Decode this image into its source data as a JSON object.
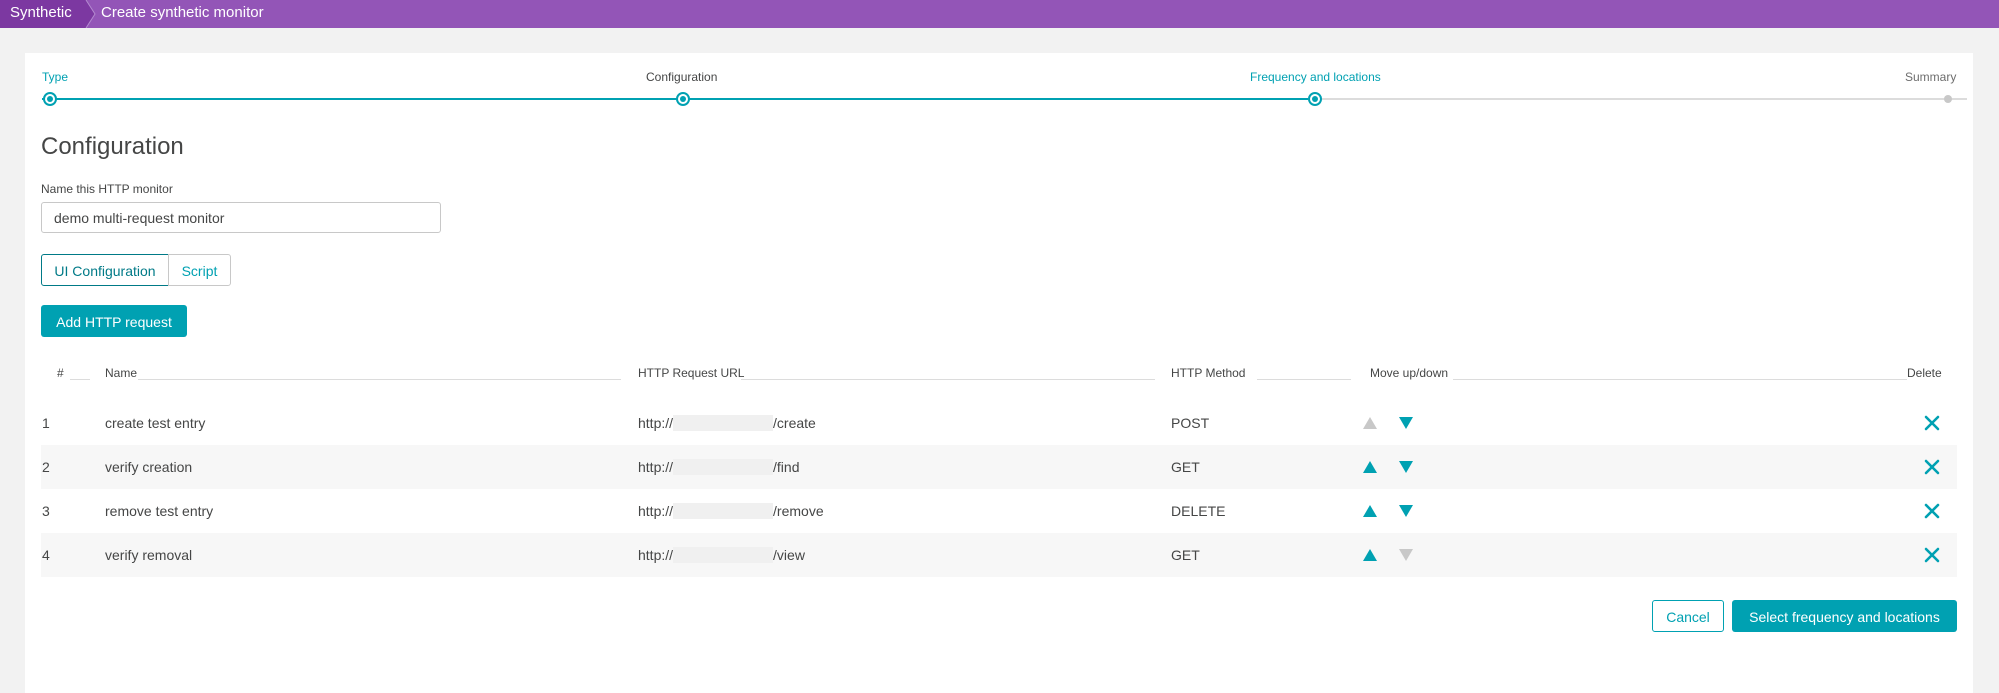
{
  "breadcrumb": {
    "root": "Synthetic",
    "current": "Create synthetic monitor"
  },
  "stepper": {
    "steps": [
      {
        "label": "Type",
        "state": "done"
      },
      {
        "label": "Configuration",
        "state": "current"
      },
      {
        "label": "Frequency and locations",
        "state": "done"
      },
      {
        "label": "Summary",
        "state": "todo"
      }
    ]
  },
  "config": {
    "title": "Configuration",
    "name_label": "Name this HTTP monitor",
    "name_value": "demo multi-request monitor"
  },
  "toggle": {
    "ui": "UI Configuration",
    "script": "Script"
  },
  "add_request_label": "Add HTTP request",
  "table": {
    "headers": {
      "num": "#",
      "name": "Name",
      "url": "HTTP Request URL",
      "method": "HTTP Method",
      "move": "Move up/down",
      "delete": "Delete"
    },
    "rows": [
      {
        "num": "1",
        "name": "create test entry",
        "url_prefix": "http://",
        "url_suffix": "/create",
        "method": "POST",
        "up_enabled": false,
        "down_enabled": true
      },
      {
        "num": "2",
        "name": "verify creation",
        "url_prefix": "http://",
        "url_suffix": "/find",
        "method": "GET",
        "up_enabled": true,
        "down_enabled": true
      },
      {
        "num": "3",
        "name": "remove test entry",
        "url_prefix": "http://",
        "url_suffix": "/remove",
        "method": "DELETE",
        "up_enabled": true,
        "down_enabled": true
      },
      {
        "num": "4",
        "name": "verify removal",
        "url_prefix": "http://",
        "url_suffix": "/view",
        "method": "GET",
        "up_enabled": true,
        "down_enabled": false
      }
    ]
  },
  "footer": {
    "cancel_label": "Cancel",
    "next_label": "Select frequency and locations"
  },
  "colors": {
    "brand_purple": "#9355b7",
    "accent_teal": "#00a1b2"
  },
  "icons": {
    "up": "triangle-up-icon",
    "down": "triangle-down-icon",
    "delete": "close-icon"
  }
}
